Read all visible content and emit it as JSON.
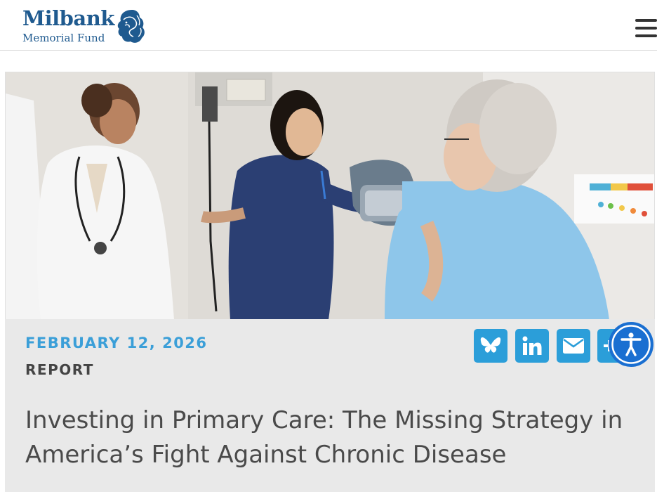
{
  "brand": {
    "name_line1": "Milbank",
    "name_line2": "Memorial Fund",
    "color": "#1f5a8f"
  },
  "header": {
    "menu_icon": "hamburger-menu-icon"
  },
  "hero": {
    "image_desc_icon": "photo"
  },
  "article": {
    "date": "FEBRUARY 12, 2026",
    "type": "REPORT",
    "title": "Investing in Primary Care: The Missing Strategy in America’s Fight Against Chronic Disease"
  },
  "share": {
    "buttons": [
      {
        "icon": "bluesky-icon"
      },
      {
        "icon": "linkedin-icon"
      },
      {
        "icon": "email-icon"
      },
      {
        "icon": "more-share-icon"
      }
    ],
    "color": "#2b9ed9"
  },
  "accessibility": {
    "icon": "accessibility-icon",
    "color": "#1a6fd1"
  },
  "colors": {
    "date": "#3b9fd8",
    "card_bg": "#e9e9e9",
    "title": "#4a4a4a"
  }
}
